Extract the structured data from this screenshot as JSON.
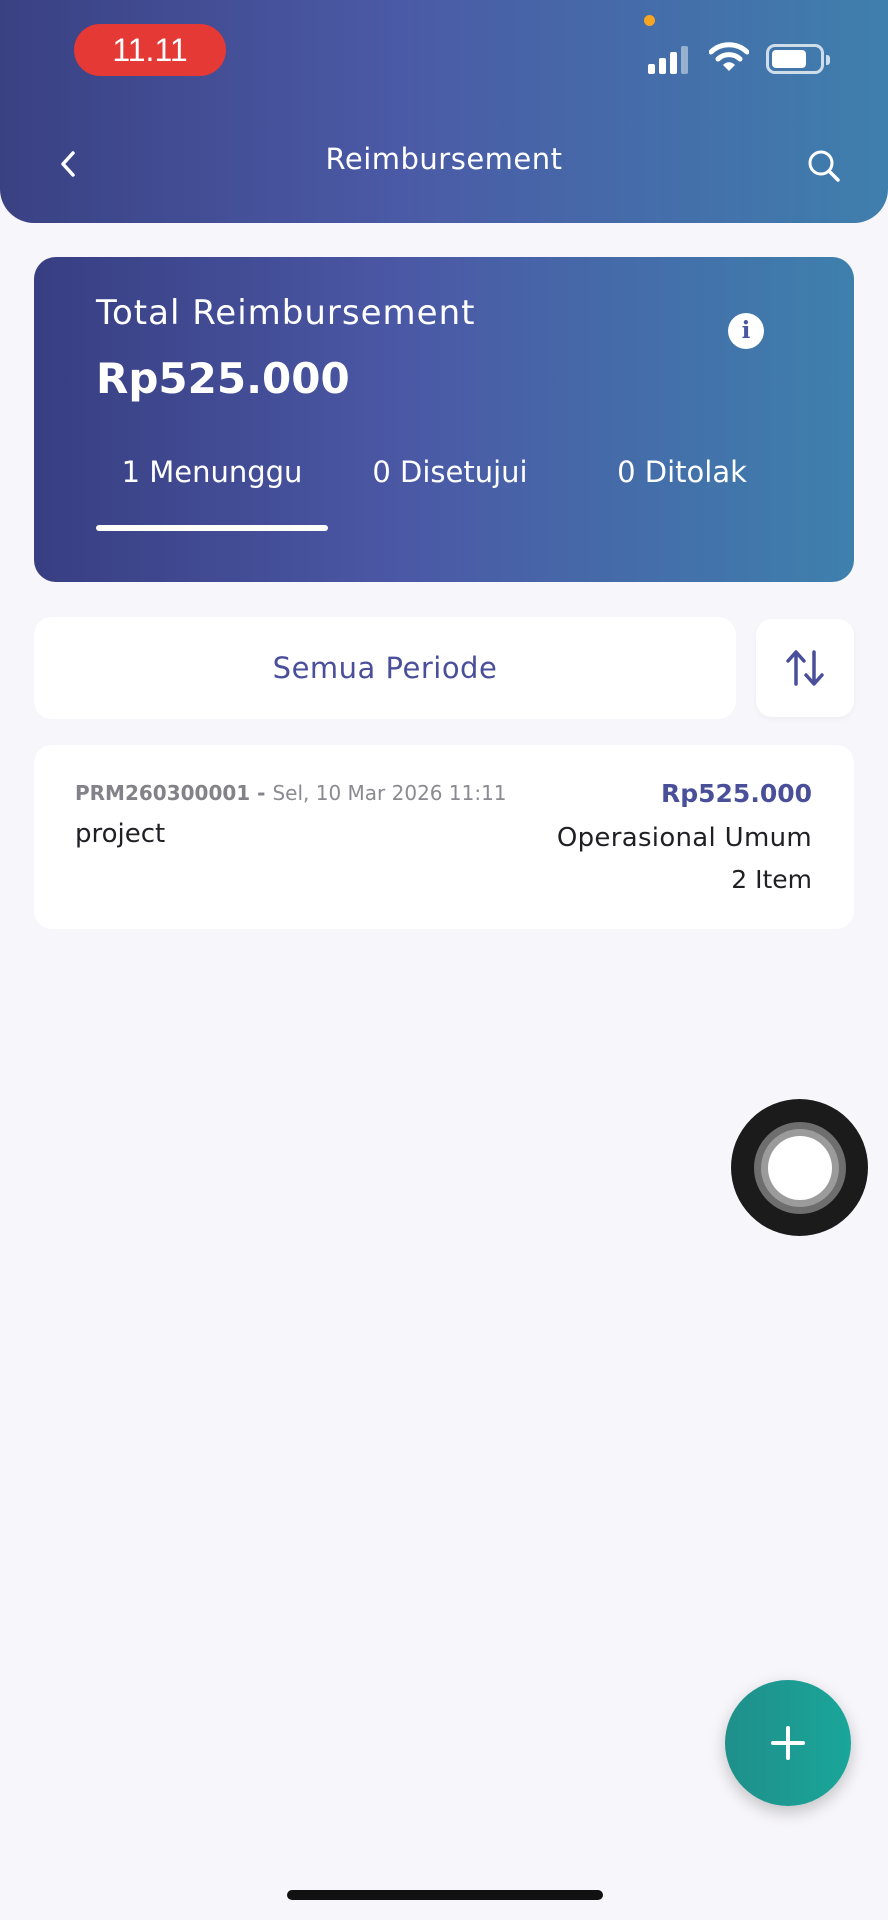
{
  "status_bar": {
    "time": "11.11"
  },
  "header": {
    "title": "Reimbursement"
  },
  "summary": {
    "label": "Total Reimbursement",
    "amount": "Rp525.000",
    "tabs": [
      {
        "label": "1 Menunggu",
        "selected": true
      },
      {
        "label": "0 Disetujui",
        "selected": false
      },
      {
        "label": "0 Ditolak",
        "selected": false
      }
    ]
  },
  "filter": {
    "period_label": "Semua Periode"
  },
  "items": [
    {
      "code": "PRM260300001",
      "separator": " - ",
      "date": "Sel, 10 Mar 2026 11:11",
      "title": "project",
      "amount": "Rp525.000",
      "category": "Operasional Umum",
      "count": "2 Item"
    }
  ],
  "colors": {
    "header_gradient": [
      "#3a4183",
      "#4b5aa6",
      "#3f7fad"
    ],
    "accent_text": "#4a4f9a",
    "fab": "#1aa69a",
    "time_pill": "#e53935"
  },
  "icons": {
    "back": "chevron-left-icon",
    "search": "search-icon",
    "info": "info-icon",
    "sort": "sort-arrows-icon",
    "add": "plus-icon"
  }
}
